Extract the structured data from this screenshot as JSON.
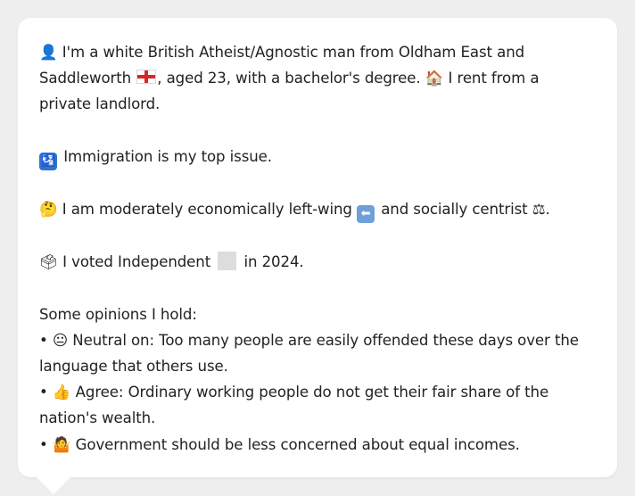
{
  "profile": {
    "intro_part1": "I'm a white British Atheist/Agnostic man from Oldham East and Saddleworth",
    "intro_part2": ", aged 23, with a bachelor's degree.",
    "intro_part3": "I rent from a private landlord.",
    "top_issue": "Immigration is my top issue.",
    "stance_part1": "I am moderately economically left-wing",
    "stance_part2": "and socially centrist",
    "stance_part3": ".",
    "vote_part1": "I voted Independent",
    "vote_part2": "in 2024.",
    "opinions_heading": "Some opinions I hold:",
    "opinions": [
      {
        "bullet": "•",
        "text": "Neutral on: Too many people are easily offended these days over the language that others use."
      },
      {
        "bullet": "•",
        "text": "Agree: Ordinary working people do not get their fair share of the nation's wealth."
      },
      {
        "bullet": "•",
        "text": "Government should be less concerned about equal incomes."
      }
    ]
  },
  "icons": {
    "person": "person-silhouette-icon",
    "flag": "england-flag-icon",
    "house": "house-icon",
    "immigration": "passport-control-icon",
    "thinking": "thinking-face-icon",
    "left_arrow": "left-arrow-icon",
    "balance": "balance-scale-icon",
    "ballot": "ballot-box-icon",
    "neutral": "neutral-face-icon",
    "thumbs_up": "thumbs-up-icon",
    "shrug": "shrug-icon"
  },
  "colors": {
    "background": "#eeeeee",
    "bubble": "#ffffff",
    "text": "#222222",
    "party_swatch": "#dddddd"
  }
}
